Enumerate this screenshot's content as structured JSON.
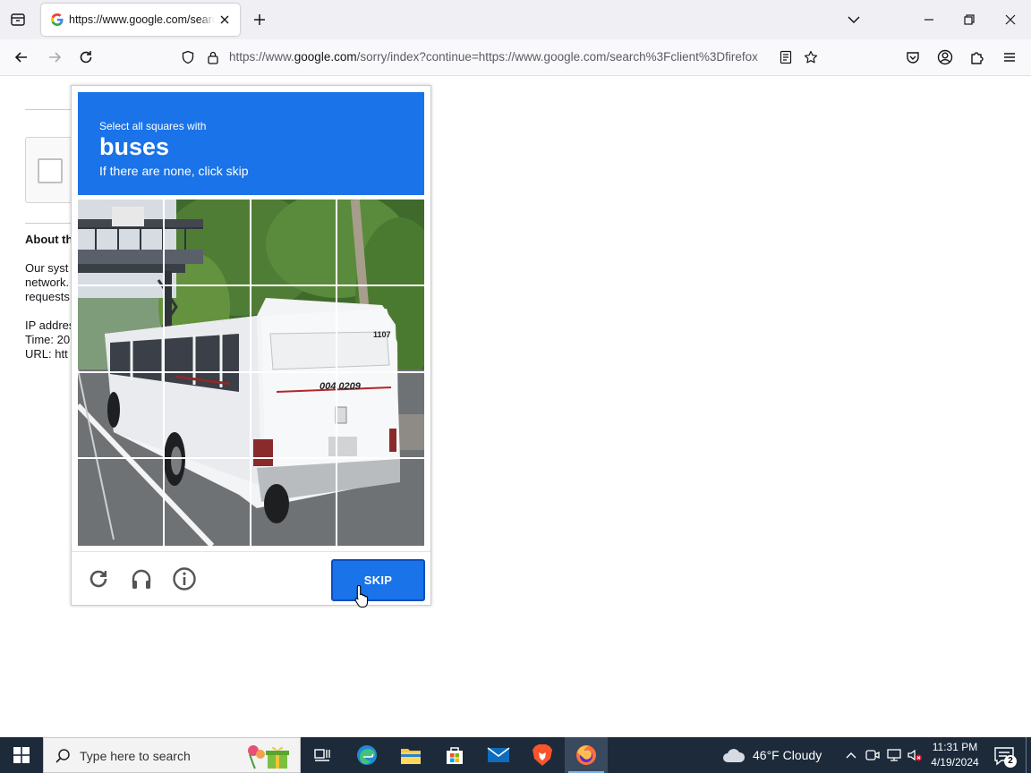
{
  "browser": {
    "tab": {
      "title": "https://www.google.com/search?client=firefox"
    },
    "url": {
      "prefix": "https://www.",
      "host": "google.com",
      "rest": "/sorry/index?continue=https://www.google.com/search%3Fclient%3Dfirefox"
    },
    "icons": {
      "tab_list": "tab-list-icon",
      "new_tab": "plus-icon",
      "overflow": "chevron-down-icon",
      "back": "back-arrow-icon",
      "forward": "forward-arrow-icon",
      "reload": "reload-icon",
      "tracking": "shield-icon",
      "lock": "lock-icon",
      "reader": "reader-view-icon",
      "bookmark": "star-icon",
      "pocket": "pocket-icon",
      "account": "account-icon",
      "extensions": "puzzle-icon",
      "menu": "hamburger-menu-icon"
    }
  },
  "page": {
    "about_title": "About th",
    "about_lines": [
      "Our syst",
      "network.",
      "requests"
    ],
    "info_lines": [
      "IP addres",
      "Time: 20",
      "URL: htt"
    ]
  },
  "captcha": {
    "instruction": "Select all squares with",
    "target": "buses",
    "hint": "If there are none, click skip",
    "skip_label": "SKIP",
    "grid": {
      "rows": 4,
      "cols": 4
    },
    "bus_number": "004.0209",
    "bus_id": "1107",
    "colors": {
      "accent": "#1a73e8"
    }
  },
  "taskbar": {
    "search_placeholder": "Type here to search",
    "weather": "46°F  Cloudy",
    "time": "11:31 PM",
    "date": "4/19/2024",
    "notification_count": "2"
  }
}
